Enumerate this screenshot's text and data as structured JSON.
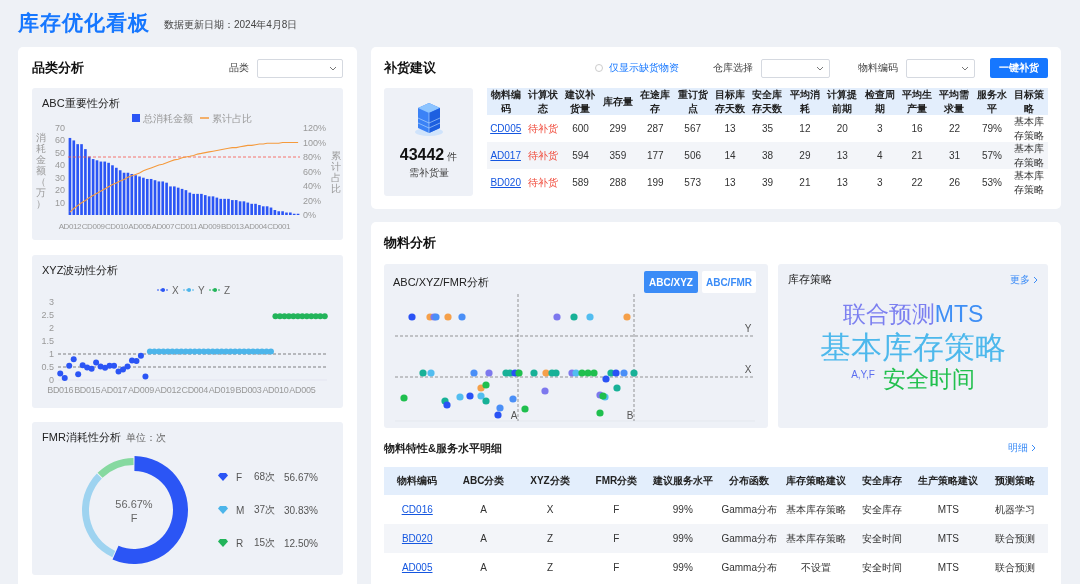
{
  "header": {
    "title": "库存优化看板",
    "updated": "数据更新日期：2024年4月8日"
  },
  "category_panel": {
    "title": "品类分析",
    "filter": {
      "label": "品类"
    },
    "abc": {
      "title": "ABC重要性分析",
      "chart_data": {
        "type": "bar",
        "legend": "top",
        "ref_lines": [
          {
            "value": 80,
            "axis": "y2",
            "color": "#f5574b"
          }
        ],
        "ylabel": "消耗金额（万）",
        "y2label": "累计占比",
        "categories": [
          "AD012",
          null,
          null,
          null,
          null,
          null,
          "CD009",
          null,
          null,
          null,
          null,
          null,
          "CD010",
          null,
          null,
          null,
          null,
          null,
          "AD005",
          null,
          null,
          null,
          null,
          null,
          "AD007",
          null,
          null,
          null,
          null,
          null,
          "CD011",
          null,
          null,
          null,
          null,
          null,
          "AD009",
          null,
          null,
          null,
          null,
          null,
          "BD013",
          null,
          null,
          null,
          null,
          null,
          "AD004",
          null,
          null,
          null,
          null,
          null,
          "CD001",
          null,
          null,
          null,
          null,
          null
        ],
        "ylim": [
          0,
          70
        ],
        "yticks": [
          10,
          20,
          30,
          40,
          50,
          60,
          70
        ],
        "y2lim": [
          0,
          120
        ],
        "y2ticks": [
          {
            "value": 0,
            "label": "0%"
          },
          {
            "value": 20,
            "label": "20%"
          },
          {
            "value": 40,
            "label": "40%"
          },
          {
            "value": 60,
            "label": "60%"
          },
          {
            "value": 80,
            "label": "80%"
          },
          {
            "value": 100,
            "label": "100%"
          },
          {
            "value": 120,
            "label": "120%"
          }
        ],
        "series": [
          {
            "name": "总消耗金额",
            "color": "#2b55f5",
            "values": [
              62,
              60,
              57,
              57,
              53,
              47,
              45,
              44,
              43,
              43,
              42,
              40,
              38,
              36,
              34,
              34,
              33,
              32,
              31,
              30,
              29,
              29,
              28,
              27,
              27,
              26,
              23,
              23,
              22,
              21,
              20,
              18,
              17,
              17,
              17,
              16,
              15,
              15,
              14,
              13,
              13,
              13,
              12,
              12,
              11,
              11,
              10,
              9,
              9,
              8,
              7,
              7,
              6,
              4,
              3,
              3,
              2,
              2,
              1,
              1
            ]
          },
          {
            "name": "累计占比",
            "type": "line",
            "color": "#f59a3c",
            "axis": "y2",
            "values": [
              4,
              9,
              13,
              17,
              20,
              24,
              27,
              30,
              33,
              36,
              39,
              42,
              44,
              47,
              49,
              52,
              54,
              56,
              58,
              61,
              63,
              65,
              67,
              69,
              70,
              72,
              74,
              76,
              77,
              79,
              80,
              81,
              82,
              84,
              85,
              86,
              87,
              88,
              89,
              90,
              91,
              92,
              93,
              93,
              94,
              95,
              96,
              96,
              97,
              98,
              98,
              99,
              99,
              99,
              99,
              100,
              100,
              100,
              100,
              100
            ]
          }
        ]
      }
    },
    "xyz": {
      "title": "XYZ波动性分析",
      "chart_data": {
        "type": "scatter",
        "legend": "top",
        "ref_lines": [
          {
            "value": 0.5,
            "axis": "y",
            "color": "#333333"
          },
          {
            "value": 1,
            "axis": "y",
            "color": "#333333"
          }
        ],
        "categories": [
          "BD016",
          null,
          null,
          null,
          null,
          null,
          "BD015",
          null,
          null,
          null,
          null,
          null,
          "AD017",
          null,
          null,
          null,
          null,
          null,
          "AD009",
          null,
          null,
          null,
          null,
          null,
          "AD012",
          null,
          null,
          null,
          null,
          null,
          "CD004",
          null,
          null,
          null,
          null,
          null,
          "AD019",
          null,
          null,
          null,
          null,
          null,
          "BD003",
          null,
          null,
          null,
          null,
          null,
          "AD010",
          null,
          null,
          null,
          null,
          null,
          "AD005",
          null,
          null,
          null,
          null,
          null
        ],
        "ylim": [
          0,
          3
        ],
        "yticks": [
          {
            "value": 0,
            "label": "0"
          },
          {
            "value": 0.5,
            "label": "0.5"
          },
          {
            "value": 1,
            "label": "1"
          },
          {
            "value": 1.5,
            "label": "1.5"
          },
          {
            "value": 2,
            "label": "2"
          },
          {
            "value": 2.5,
            "label": "2.5"
          },
          {
            "value": 3,
            "label": "3"
          }
        ],
        "series": [
          {
            "name": "X",
            "color": "#2b55f5",
            "values": [
              0.25,
              0.08,
              0.55,
              0.8,
              0.22,
              0.57,
              0.48,
              0.43,
              0.67,
              0.52,
              0.47,
              0.55,
              0.55,
              0.33,
              0.4,
              0.52,
              0.75,
              0.73,
              0.93,
              0.13,
              null,
              null,
              null,
              null,
              null,
              null,
              null,
              null,
              null,
              null,
              null,
              null,
              null,
              null,
              null,
              null,
              null,
              null,
              null,
              null,
              null,
              null,
              null,
              null,
              null,
              null,
              null,
              null,
              null,
              null,
              null,
              null,
              null,
              null,
              null,
              null,
              null,
              null,
              null,
              null
            ]
          },
          {
            "name": "Y",
            "color": "#4cb5ea",
            "values": [
              null,
              null,
              null,
              null,
              null,
              null,
              null,
              null,
              null,
              null,
              null,
              null,
              null,
              null,
              null,
              null,
              null,
              null,
              null,
              null,
              1.1,
              1.1,
              1.1,
              1.1,
              1.1,
              1.1,
              1.1,
              1.1,
              1.1,
              1.1,
              1.1,
              1.1,
              1.1,
              1.1,
              1.1,
              1.1,
              1.1,
              1.1,
              1.1,
              1.1,
              1.1,
              1.1,
              1.1,
              1.1,
              1.1,
              1.1,
              1.1,
              1.1,
              null,
              null,
              null,
              null,
              null,
              null,
              null,
              null,
              null,
              null,
              null,
              null
            ]
          },
          {
            "name": "Z",
            "color": "#22b45a",
            "values": [
              null,
              null,
              null,
              null,
              null,
              null,
              null,
              null,
              null,
              null,
              null,
              null,
              null,
              null,
              null,
              null,
              null,
              null,
              null,
              null,
              null,
              null,
              null,
              null,
              null,
              null,
              null,
              null,
              null,
              null,
              null,
              null,
              null,
              null,
              null,
              null,
              null,
              null,
              null,
              null,
              null,
              null,
              null,
              null,
              null,
              null,
              null,
              null,
              2.45,
              2.45,
              2.45,
              2.45,
              2.45,
              2.45,
              2.45,
              2.45,
              2.45,
              2.45,
              2.45,
              2.45
            ]
          }
        ]
      }
    },
    "fmr": {
      "title": "FMR消耗性分析",
      "unit": "单位：次",
      "center_value": "56.67%",
      "center_label": "F",
      "chart_data": {
        "type": "donut",
        "categories": [
          "F",
          "M",
          "R"
        ],
        "series": [
          {
            "values": [
              56.67,
              30.83,
              12.5
            ]
          }
        ]
      },
      "legend": [
        {
          "count": "68次",
          "share": "56.67%",
          "color": "#2b55f5"
        },
        {
          "count": "37次",
          "share": "30.83%",
          "color": "#4cb5ea"
        },
        {
          "count": "15次",
          "share": "12.50%",
          "color": "#22b45a"
        }
      ]
    }
  },
  "replenishment": {
    "title": "补货建议",
    "shortage_only": {
      "label": "仅显示缺货物资",
      "checked": false
    },
    "warehouse": {
      "label": "仓库选择"
    },
    "material": {
      "label": "物料编码"
    },
    "action": "一键补货",
    "summary": {
      "value": "43442",
      "unit": "件",
      "label": "需补货量"
    },
    "table": {
      "columns": [
        "物料编码",
        "计算状态",
        "建议补货量",
        "库存量",
        "在途库存",
        "重订货点",
        "目标库存天数",
        "安全库存天数",
        "平均消耗",
        "计算提前期",
        "检查周期",
        "平均生产量",
        "平均需求量",
        "服务水平",
        "目标策略"
      ],
      "rows": [
        [
          "CD005",
          "待补货",
          "600",
          "299",
          "287",
          "567",
          "13",
          "35",
          "12",
          "20",
          "3",
          "16",
          "22",
          "79%",
          "基本库存策略"
        ],
        [
          "AD017",
          "待补货",
          "594",
          "359",
          "177",
          "506",
          "14",
          "38",
          "29",
          "13",
          "4",
          "21",
          "31",
          "57%",
          "基本库存策略"
        ],
        [
          "BD020",
          "待补货",
          "589",
          "288",
          "199",
          "573",
          "13",
          "39",
          "21",
          "13",
          "3",
          "22",
          "26",
          "53%",
          "基本库存策略"
        ]
      ]
    }
  },
  "material": {
    "title": "物料分析",
    "matrix": {
      "title": "ABC/XYZ/FMR分析",
      "tabs": [
        {
          "label": "ABC/XYZ",
          "selected": true
        },
        {
          "label": "ABC/FMR",
          "selected": false
        }
      ],
      "y_labels": [
        "Y",
        "X"
      ],
      "x_labels": [
        "A",
        "B"
      ]
    },
    "strategy": {
      "title": "库存策略",
      "more": "更多",
      "lines": [
        [
          {
            "text": "联合预测",
            "color": "#7b7ff0",
            "kind": "medium"
          },
          {
            "text": "MTS",
            "color": "#3f8ff5",
            "kind": "medium"
          }
        ],
        [
          {
            "text": "基本库存策略",
            "color": "#4db8ec",
            "kind": "large"
          }
        ],
        [
          {
            "text": "A,Y,F",
            "color": "#5b6ef0",
            "kind": "small"
          },
          {
            "text": "安全时间",
            "color": "#22c04e",
            "kind": "medium"
          }
        ]
      ]
    },
    "detail": {
      "title": "物料特性&服务水平明细",
      "more": "明细",
      "table": {
        "columns": [
          "物料编码",
          "ABC分类",
          "XYZ分类",
          "FMR分类",
          "建议服务水平",
          "分布函数",
          "库存策略建议",
          "安全库存",
          "生产策略建议",
          "预测策略"
        ],
        "rows": [
          [
            "CD016",
            "A",
            "X",
            "F",
            "99%",
            "Gamma分布",
            "基本库存策略",
            "安全库存",
            "MTS",
            "机器学习"
          ],
          [
            "BD020",
            "A",
            "Z",
            "F",
            "99%",
            "Gamma分布",
            "基本库存策略",
            "安全时间",
            "MTS",
            "联合预测"
          ],
          [
            "AD005",
            "A",
            "Z",
            "F",
            "99%",
            "Gamma分布",
            "不设置",
            "安全时间",
            "MTS",
            "联合预测"
          ]
        ]
      }
    }
  }
}
